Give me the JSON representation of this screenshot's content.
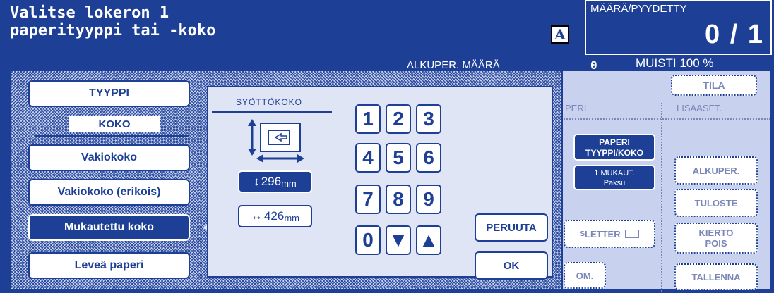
{
  "header": {
    "title_line1": "Valitse lokeron 1",
    "title_line2": "paperityyppi tai -koko",
    "mode_icon_letter": "A",
    "count_label": "MÄÄRÄ/PYYDETTY",
    "count_value": "0 / 1",
    "memory": "MUISTI 100 %",
    "original_count_label": "ALKUPER. MÄÄRÄ",
    "original_count_value": "0"
  },
  "left_panel": {
    "type_button": "TYYPPI",
    "size_header": "KOKO",
    "size_buttons": [
      "Vakiokoko",
      "Vakiokoko (erikois)",
      "Mukautettu koko",
      "Leveä paperi"
    ],
    "selected_size_index": 2
  },
  "input_panel": {
    "feed_size_label": "SYÖTTÖKOKO",
    "height_value": "296",
    "width_value": "426",
    "unit": "mm",
    "height_arrow": "↕",
    "width_arrow": "↔",
    "keys": [
      "1",
      "2",
      "3",
      "4",
      "5",
      "6",
      "7",
      "8",
      "9",
      "0",
      "▼",
      "▲"
    ],
    "cancel_button": "PERUUTA",
    "ok_button": "OK"
  },
  "background": {
    "status_button": "TILA",
    "col_header_left": "PERI",
    "col_header_right": "LISÄASET.",
    "paper_button_line1": "PAPERI",
    "paper_button_line2": "TYYPPI/KOKO",
    "custom_button_line1": "1 MUKAUT.",
    "custom_button_line2": "Paksu",
    "letter_button": "LETTER",
    "letter_superscript": "S",
    "partial_button": "OM.",
    "original_button": "ALKUPER.",
    "output_button": "TULOSTE",
    "remove_button_line1": "KIERTO",
    "remove_button_line2": "POIS",
    "save_button": "TALLENNA"
  },
  "colors": {
    "primary": "#1e3f96",
    "panel": "#c8d2ee",
    "inner": "#dfe5f5"
  }
}
